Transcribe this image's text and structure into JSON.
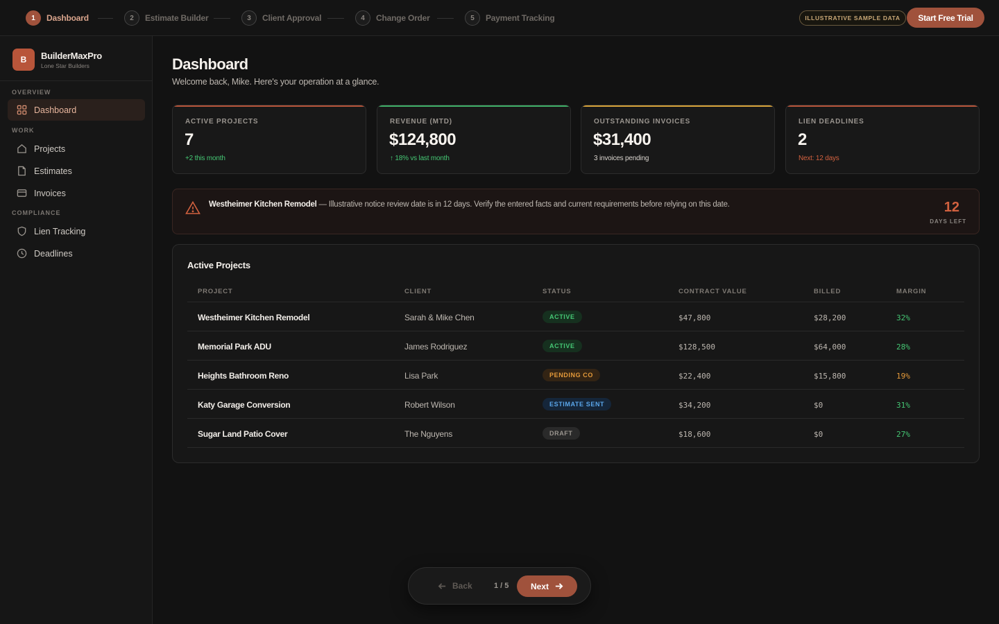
{
  "stepper": {
    "steps": [
      {
        "num": "1",
        "label": "Dashboard"
      },
      {
        "num": "2",
        "label": "Estimate Builder"
      },
      {
        "num": "3",
        "label": "Client Approval"
      },
      {
        "num": "4",
        "label": "Change Order"
      },
      {
        "num": "5",
        "label": "Payment Tracking"
      }
    ],
    "active_step": 1,
    "sample_badge": "ILLUSTRATIVE SAMPLE DATA",
    "trial_button": "Start Free Trial"
  },
  "sidebar": {
    "brand_initial": "B",
    "brand_name": "BuilderMaxPro",
    "brand_sub": "Lone Star Builders",
    "sections": {
      "overview": "OVERVIEW",
      "work": "WORK",
      "compliance": "COMPLIANCE"
    },
    "items": {
      "dashboard": "Dashboard",
      "projects": "Projects",
      "estimates": "Estimates",
      "invoices": "Invoices",
      "lien_tracking": "Lien Tracking",
      "deadlines": "Deadlines"
    }
  },
  "main": {
    "title": "Dashboard",
    "subtitle": "Welcome back, Mike. Here's your operation at a glance.",
    "kpis": [
      {
        "label": "ACTIVE PROJECTS",
        "value": "7",
        "note": "+2 this month",
        "accent": "#b8553a",
        "note_color": "#45c774"
      },
      {
        "label": "REVENUE (MTD)",
        "value": "$124,800",
        "note": "↑ 18% vs last month",
        "accent": "#3fb068",
        "note_color": "#45c774"
      },
      {
        "label": "OUTSTANDING INVOICES",
        "value": "$31,400",
        "note": "3 invoices pending",
        "accent": "#d8a33a",
        "note_color": "#d9d4ce"
      },
      {
        "label": "LIEN DEADLINES",
        "value": "2",
        "note": "Next: 12 days",
        "accent": "#b8553a",
        "note_color": "#d2613f"
      }
    ],
    "alert": {
      "project": "Westheimer Kitchen Remodel",
      "message": " — Illustrative notice review date is in 12 days. Verify the entered facts and current requirements before relying on this date.",
      "days": "12",
      "days_label": "DAYS LEFT"
    },
    "projects_panel": {
      "title": "Active Projects",
      "columns": [
        "PROJECT",
        "CLIENT",
        "STATUS",
        "CONTRACT VALUE",
        "BILLED",
        "MARGIN"
      ],
      "rows": [
        {
          "project": "Westheimer Kitchen Remodel",
          "client": "Sarah & Mike Chen",
          "status": "ACTIVE",
          "status_kind": "active",
          "contract": "$47,800",
          "billed": "$28,200",
          "margin": "32%",
          "margin_color": "#45c774"
        },
        {
          "project": "Memorial Park ADU",
          "client": "James Rodriguez",
          "status": "ACTIVE",
          "status_kind": "active",
          "contract": "$128,500",
          "billed": "$64,000",
          "margin": "28%",
          "margin_color": "#45c774"
        },
        {
          "project": "Heights Bathroom Reno",
          "client": "Lisa Park",
          "status": "PENDING CO",
          "status_kind": "pending",
          "contract": "$22,400",
          "billed": "$15,800",
          "margin": "19%",
          "margin_color": "#e59a3a"
        },
        {
          "project": "Katy Garage Conversion",
          "client": "Robert Wilson",
          "status": "ESTIMATE SENT",
          "status_kind": "sent",
          "contract": "$34,200",
          "billed": "$0",
          "margin": "31%",
          "margin_color": "#45c774"
        },
        {
          "project": "Sugar Land Patio Cover",
          "client": "The Nguyens",
          "status": "DRAFT",
          "status_kind": "draft",
          "contract": "$18,600",
          "billed": "$0",
          "margin": "27%",
          "margin_color": "#45c774"
        }
      ]
    }
  },
  "pager": {
    "back": "Back",
    "count": "1 / 5",
    "next": "Next"
  }
}
